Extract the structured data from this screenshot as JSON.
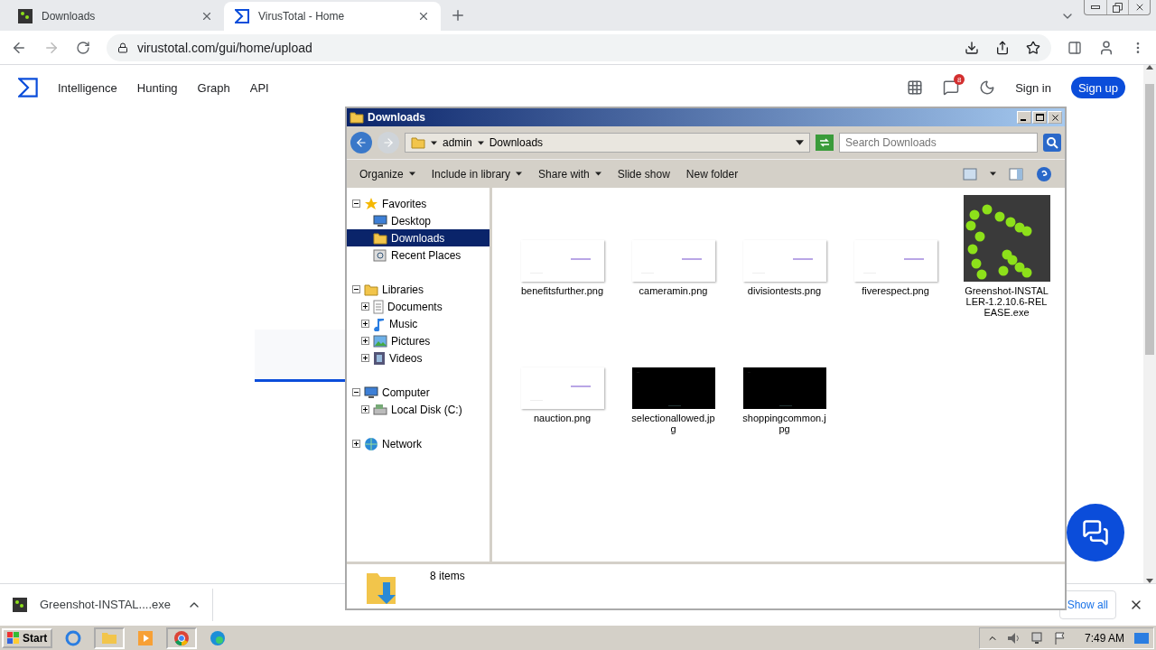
{
  "browser": {
    "tabs": [
      {
        "title": "Downloads",
        "selected": false
      },
      {
        "title": "VirusTotal - Home",
        "selected": true
      }
    ],
    "address": "virustotal.com/gui/home/upload"
  },
  "site": {
    "nav": [
      "Intelligence",
      "Hunting",
      "Graph",
      "API"
    ],
    "notification_count": "8",
    "sign_in": "Sign in",
    "sign_up": "Sign up"
  },
  "download_shelf": {
    "file": "Greenshot-INSTAL....exe",
    "show_all": "Show all"
  },
  "explorer": {
    "title": "Downloads",
    "breadcrumb": [
      "admin",
      "Downloads"
    ],
    "search_placeholder": "Search Downloads",
    "toolbar": [
      {
        "label": "Organize",
        "dropdown": true
      },
      {
        "label": "Include in library",
        "dropdown": true
      },
      {
        "label": "Share with",
        "dropdown": true
      },
      {
        "label": "Slide show",
        "dropdown": false
      },
      {
        "label": "New folder",
        "dropdown": false
      }
    ],
    "tree": [
      {
        "label": "Favorites",
        "expanded": true,
        "children": [
          {
            "label": "Desktop",
            "selected": false
          },
          {
            "label": "Downloads",
            "selected": true
          },
          {
            "label": "Recent Places",
            "selected": false
          }
        ]
      },
      {
        "label": "Libraries",
        "expanded": true,
        "children": [
          {
            "label": "Documents",
            "expanded": false,
            "selected": false
          },
          {
            "label": "Music",
            "expanded": false,
            "selected": false
          },
          {
            "label": "Pictures",
            "expanded": false,
            "selected": false
          },
          {
            "label": "Videos",
            "expanded": false,
            "selected": false
          }
        ]
      },
      {
        "label": "Computer",
        "expanded": true,
        "children": [
          {
            "label": "Local Disk (C:)",
            "expanded": false,
            "selected": false
          }
        ]
      },
      {
        "label": "Network",
        "expanded": false
      }
    ],
    "files": [
      {
        "name": "benefitsfurther.png",
        "kind": "light"
      },
      {
        "name": "cameramin.png",
        "kind": "light"
      },
      {
        "name": "divisiontests.png",
        "kind": "light"
      },
      {
        "name": "fiverespect.png",
        "kind": "light"
      },
      {
        "name": "Greenshot-INSTALLER-1.2.10.6-RELEASE.exe",
        "kind": "app"
      },
      {
        "name": "nauction.png",
        "kind": "light"
      },
      {
        "name": "selectionallowed.jpg",
        "kind": "dark"
      },
      {
        "name": "shoppingcommon.jpg",
        "kind": "dark"
      }
    ],
    "status": "8 items"
  },
  "taskbar": {
    "start": "Start",
    "clock": "7:49 AM"
  }
}
